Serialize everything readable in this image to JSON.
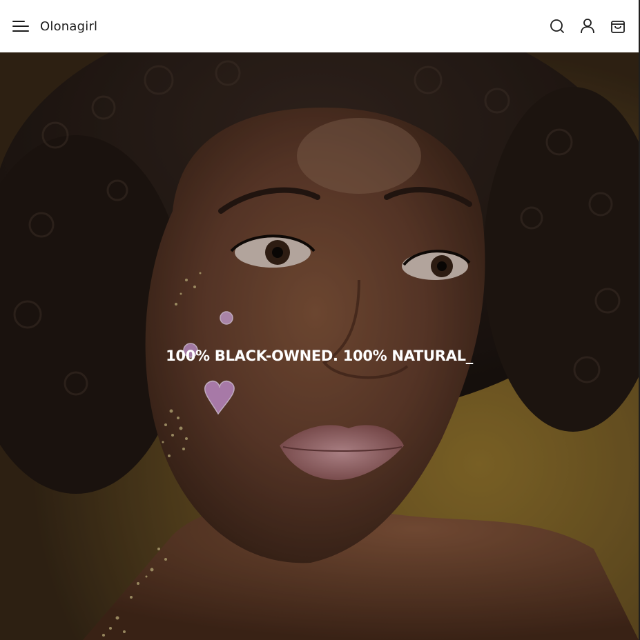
{
  "header": {
    "brand": "Olonagirl",
    "icons": {
      "menu": "hamburger-menu-icon",
      "search": "search-icon",
      "account": "user-icon",
      "cart": "shopping-bag-icon"
    }
  },
  "hero": {
    "headline": "100% BLACK-OWNED. 100% NATURAL_",
    "image": "portrait of woman with curly afro hair, glitter and heart gems on cheek"
  },
  "colors": {
    "header_bg": "#ffffff",
    "text_dark": "#1a1a1a",
    "hero_text": "#ffffff",
    "hero_bg": "#5a4326"
  }
}
